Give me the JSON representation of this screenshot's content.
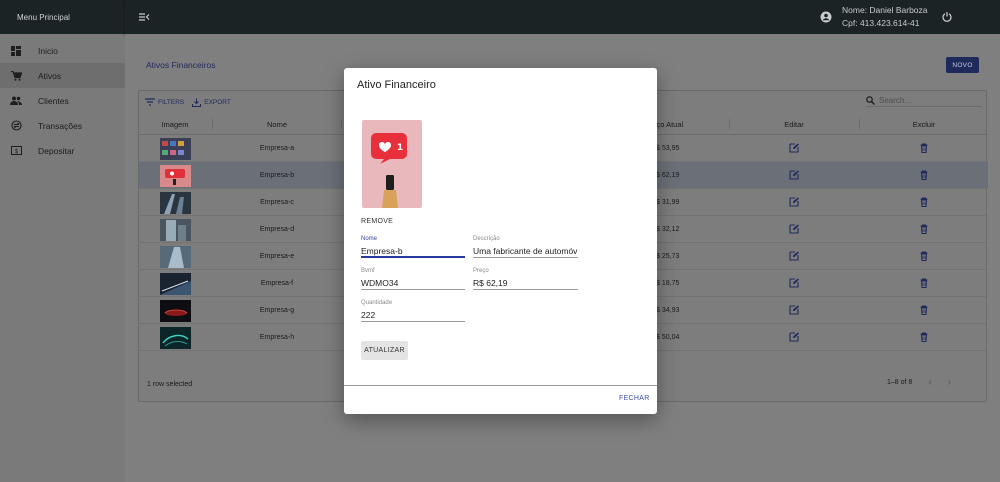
{
  "sidebar": {
    "title": "Menu Principal",
    "items": [
      {
        "label": "Inicio",
        "icon": "dashboard-icon"
      },
      {
        "label": "Ativos",
        "icon": "cart-icon"
      },
      {
        "label": "Clientes",
        "icon": "people-icon"
      },
      {
        "label": "Transações",
        "icon": "exchange-icon"
      },
      {
        "label": "Depositar",
        "icon": "money-icon"
      }
    ]
  },
  "topbar": {
    "user_name": "Nome: Daniel Barboza",
    "user_cpf": "Cpf: 413.423.614-41"
  },
  "page": {
    "title": "Ativos Financeiros",
    "new_button": "NOVO"
  },
  "grid": {
    "filters_label": "FILTERS",
    "export_label": "EXPORT",
    "search_placeholder": "Search…",
    "columns": {
      "image": "Imagem",
      "name": "Nome",
      "price": "Preço Atual",
      "edit": "Editar",
      "delete": "Excluir"
    },
    "rows": [
      {
        "name": "Empresa-a",
        "price": "R$ 53,95"
      },
      {
        "name": "Empresa-b",
        "price": "R$ 62,19"
      },
      {
        "name": "Empresa-c",
        "price": "R$ 31,99"
      },
      {
        "name": "Empresa-d",
        "price": "R$ 32,12"
      },
      {
        "name": "Empresa-e",
        "price": "R$ 25,73"
      },
      {
        "name": "Empresa-f",
        "price": "R$ 18,75"
      },
      {
        "name": "Empresa-g",
        "price": "R$ 34,93"
      },
      {
        "name": "Empresa-h",
        "price": "R$ 50,04"
      }
    ],
    "selected_row": "Empresa-b",
    "footer_selected": "1 row selected",
    "footer_pagination": "1–8 of 8"
  },
  "modal": {
    "title": "Ativo Financeiro",
    "remove_label": "REMOVE",
    "fields": {
      "nome": {
        "label": "Nome",
        "value": "Empresa-b"
      },
      "descricao": {
        "label": "Descrição",
        "value": "Uma fabricante de automóv"
      },
      "bvmf": {
        "label": "Bvmf",
        "value": "WDMO34"
      },
      "preco": {
        "label": "Preço",
        "value": "R$ 62,19"
      },
      "quantidade": {
        "label": "Quantidade",
        "value": "222"
      }
    },
    "update_label": "ATUALIZAR",
    "close_label": "FECHAR"
  },
  "colors": {
    "topbar": "#1c2324",
    "accent": "#1f2a5c",
    "link": "#3d4fa3"
  }
}
